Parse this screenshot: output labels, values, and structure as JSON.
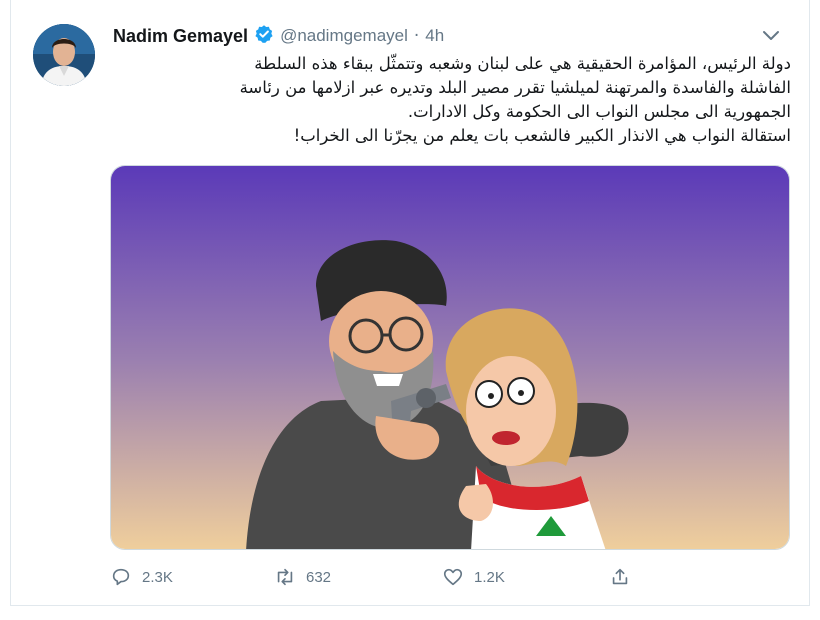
{
  "tweet": {
    "author_name": "Nadim Gemayel",
    "handle": "@nadimgemayel",
    "separator": "·",
    "time": "4h",
    "text_lines": [
      "دولة الرئيس، المؤامرة الحقيقية هي على لبنان وشعبه وتتمثّل ببقاء هذه السلطة",
      "الفاشلة والفاسدة والمرتهنة لميلشيا تقرر مصير البلد وتديره عبر ازلامها من رئاسة",
      "الجمهورية الى مجلس النواب الى الحكومة وكل الادارات.",
      "استقالة النواب هي الانذار الكبير فالشعب بات يعلم من يجرّنا الى الخراب!"
    ],
    "icons": {
      "verified": "verified-badge-icon",
      "caret": "chevron-down-icon",
      "reply": "reply-icon",
      "retweet": "retweet-icon",
      "like": "heart-icon",
      "share": "share-icon"
    },
    "actions": {
      "reply_count": "2.3K",
      "retweet_count": "632",
      "like_count": "1.2K"
    },
    "colors": {
      "verified": "#1da1f2",
      "secondary_text": "#657786",
      "primary_text": "#14171a",
      "image_gradient_top": "#5b3ab8",
      "image_gradient_bottom": "#f0cf9c"
    }
  }
}
